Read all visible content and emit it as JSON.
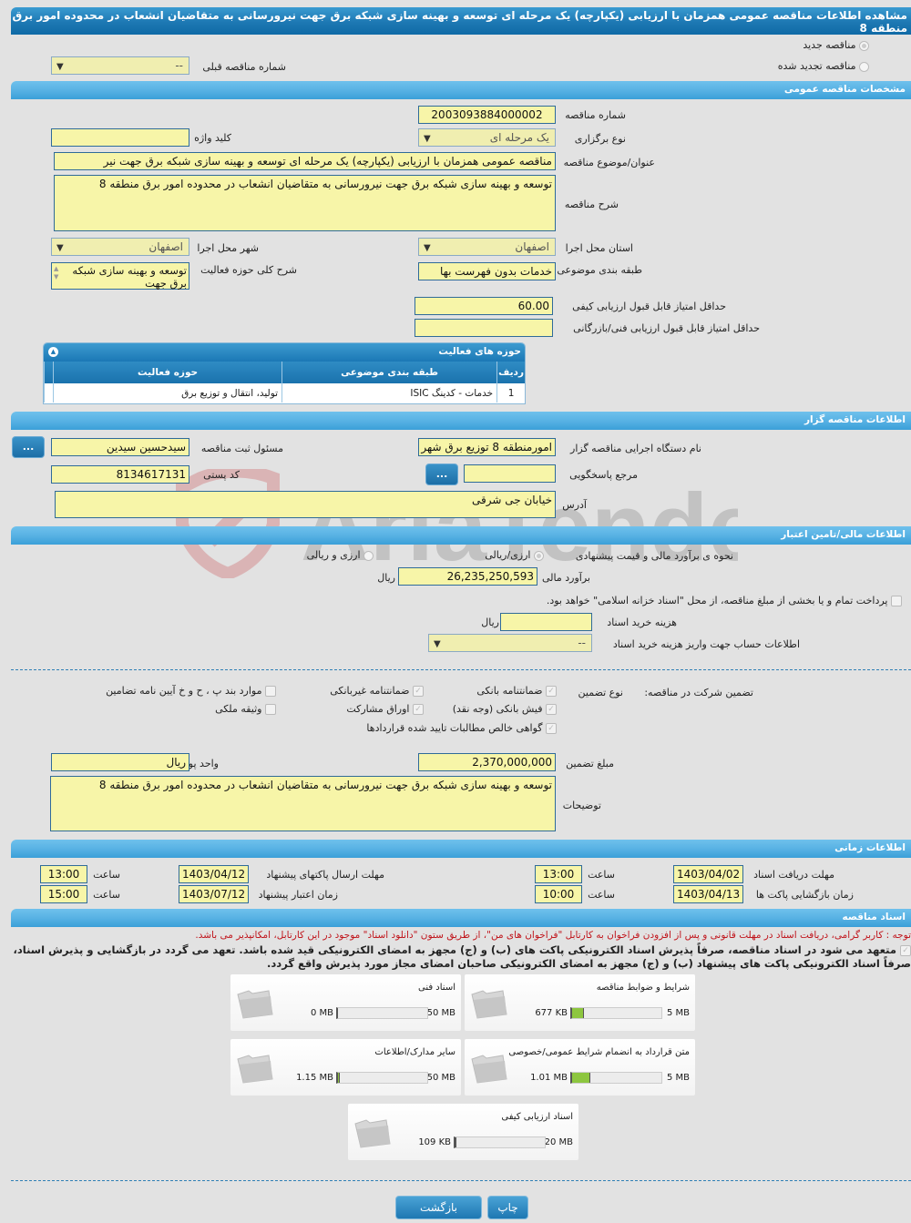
{
  "page_title": "مشاهده اطلاعات مناقصه عمومی همزمان با ارزیابی (یکپارچه) یک مرحله ای توسعه و بهینه سازی شبکه برق جهت نیرورسانی به متقاضیان انشعاب در محدوده امور برق منطقه 8",
  "tender_type": {
    "new_label": "مناقصه جدید",
    "renewed_label": "مناقصه تجدید شده",
    "previous_number_label": "شماره مناقصه قبلی",
    "previous_number_value": "--"
  },
  "general": {
    "section_title": "مشخصات مناقصه عمومی",
    "tender_number_label": "شماره مناقصه",
    "tender_number": "2003093884000002",
    "holding_type_label": "نوع برگزاری",
    "holding_type": "یک مرحله ای",
    "keyword_label": "کلید واژه",
    "keyword": "",
    "subject_label": "عنوان/موضوع مناقصه",
    "subject": "مناقصه عمومی همزمان با ارزیابی (یکپارچه) یک مرحله ای توسعه و بهینه سازی شبکه برق جهت نیر",
    "description_label": "شرح مناقصه",
    "description": "توسعه و بهینه سازی شبکه برق جهت نیرورسانی به متقاضیان انشعاب در محدوده امور برق منطقه 8",
    "province_label": "استان محل اجرا",
    "province": "اصفهان",
    "city_label": "شهر محل اجرا",
    "city": "اصفهان",
    "category_label": "طبقه بندی موضوعی",
    "category": "خدمات بدون فهرست بها",
    "activity_desc_label": "شرح کلی حوزه فعالیت",
    "activity_desc": "توسعه و بهینه سازی شبکه برق جهت",
    "min_quality_score_label": "حداقل امتیاز قابل قبول ارزیابی کیفی",
    "min_quality_score": "60.00",
    "min_tech_score_label": "حداقل امتیاز قابل قبول ارزیابی فنی/بازرگانی",
    "min_tech_score": ""
  },
  "activity_panel": {
    "title": "حوزه های فعالیت",
    "columns": [
      "ردیف",
      "طبقه بندی موضوعی",
      "حوزه فعالیت"
    ],
    "rows": [
      {
        "index": "1",
        "category": "خدمات - کدینگ ISIC",
        "activity": "تولید، انتقال و توزیع برق"
      }
    ]
  },
  "organizer": {
    "section_title": "اطلاعات مناقصه گزار",
    "org_name_label": "نام دستگاه اجرایی مناقصه گزار",
    "org_name": "امورمنطقه 8 توزیع برق شهر",
    "registrar_label": "مسئول ثبت مناقصه",
    "registrar": "سیدحسین سیدین",
    "reference_label": "مرجع پاسخگویی",
    "reference": "",
    "postal_code_label": "کد پستی",
    "postal_code": "8134617131",
    "address_label": "آدرس",
    "address": "خیابان جی شرقی",
    "more_button": "..."
  },
  "finance": {
    "section_title": "اطلاعات مالی/تامین اعتبار",
    "estimate_method_label": "نحوه ی برآورد مالی و قیمت پیشنهادی",
    "option_rial": "ارزی/ریالی",
    "option_fx_rial": "ارزی و ریالی",
    "estimate_label": "برآورد مالی",
    "estimate": "26,235,250,593",
    "currency": "ریال",
    "treasury_note": "پرداخت تمام و یا بخشی از مبلغ مناقصه، از محل \"اسناد خزانه اسلامی\" خواهد بود.",
    "doc_fee_label": "هزینه خرید اسناد",
    "doc_fee": "",
    "doc_fee_currency": "ریال",
    "account_label": "اطلاعات حساب جهت واریز هزینه خرید اسناد",
    "account": "--"
  },
  "guarantee": {
    "title_label": "تضمین شرکت در مناقصه:",
    "type_label": "نوع تضمین",
    "options": [
      {
        "label": "ضمانتنامه بانکی",
        "checked": true
      },
      {
        "label": "ضمانتنامه غیربانکی",
        "checked": true
      },
      {
        "label": "موارد بند پ ، ح و خ آیین نامه تضامین",
        "checked": false
      },
      {
        "label": "فیش بانکی (وجه نقد)",
        "checked": true
      },
      {
        "label": "اوراق مشارکت",
        "checked": true
      },
      {
        "label": "وثیقه ملکی",
        "checked": false
      },
      {
        "label": "گواهی خالص مطالبات تایید شده قراردادها",
        "checked": true
      }
    ],
    "amount_label": "مبلغ تضمین",
    "amount": "2,370,000,000",
    "currency_label": "واحد پول",
    "currency": "ریال",
    "notes_label": "توضیحات",
    "notes": "توسعه و بهینه سازی شبکه برق جهت نیرورسانی به متقاضیان انشعاب در محدوده امور برق منطقه 8"
  },
  "timing": {
    "section_title": "اطلاعات زمانی",
    "doc_deadline_label": "مهلت دریافت اسناد",
    "doc_deadline_date": "1403/04/02",
    "doc_deadline_time": "13:00",
    "submit_deadline_label": "مهلت ارسال پاکتهای پیشنهاد",
    "submit_deadline_date": "1403/04/12",
    "submit_deadline_time": "13:00",
    "opening_label": "زمان بازگشایی پاکت ها",
    "opening_date": "1403/04/13",
    "opening_time": "10:00",
    "validity_label": "زمان اعتبار پیشنهاد",
    "validity_date": "1403/07/12",
    "validity_time": "15:00",
    "time_label": "ساعت"
  },
  "documents": {
    "section_title": "اسناد مناقصه",
    "notice": "توجه : کاربر گرامی، دریافت اسناد در مهلت قانونی و پس از افزودن فراخوان به کارتابل \"فراخوان های من\"، از طریق ستون \"دانلود اسناد\" موجود در این کارتابل، امکانپذیر می باشد.",
    "commitment_line1": "متعهد می شود در اسناد مناقصه، صرفاً پذیرش اسناد الکترونیکی پاکت های (ب) و (ج) مجهز به امضای الکترونیکی قید شده باشد. تعهد می گردد در بازگشایی و پذیرش اسناد،",
    "commitment_line2": "صرفاً اسناد الکترونیکی پاکت های پیشنهاد (ب) و (ج) مجهز به امضای الکترونیکی صاحبان امضای مجاز مورد پذیرش واقع گردد.",
    "cards": [
      {
        "name": "شرایط و ضوابط مناقصه",
        "used": "677 KB",
        "max": "5 MB",
        "fill_fraction": 0.13
      },
      {
        "name": "اسناد فنی",
        "used": "0 MB",
        "max": "50 MB",
        "fill_fraction": 0.0
      },
      {
        "name": "متن قرارداد به انضمام شرایط عمومی/خصوصی",
        "used": "1.01 MB",
        "max": "5 MB",
        "fill_fraction": 0.2
      },
      {
        "name": "سایر مدارک/اطلاعات",
        "used": "1.15 MB",
        "max": "50 MB",
        "fill_fraction": 0.023
      },
      {
        "name": "اسناد ارزیابی کیفی",
        "used": "109 KB",
        "max": "20 MB",
        "fill_fraction": 0.005
      }
    ]
  },
  "buttons": {
    "print": "چاپ",
    "back": "بازگشت"
  },
  "watermark": "AriaTender.neT"
}
